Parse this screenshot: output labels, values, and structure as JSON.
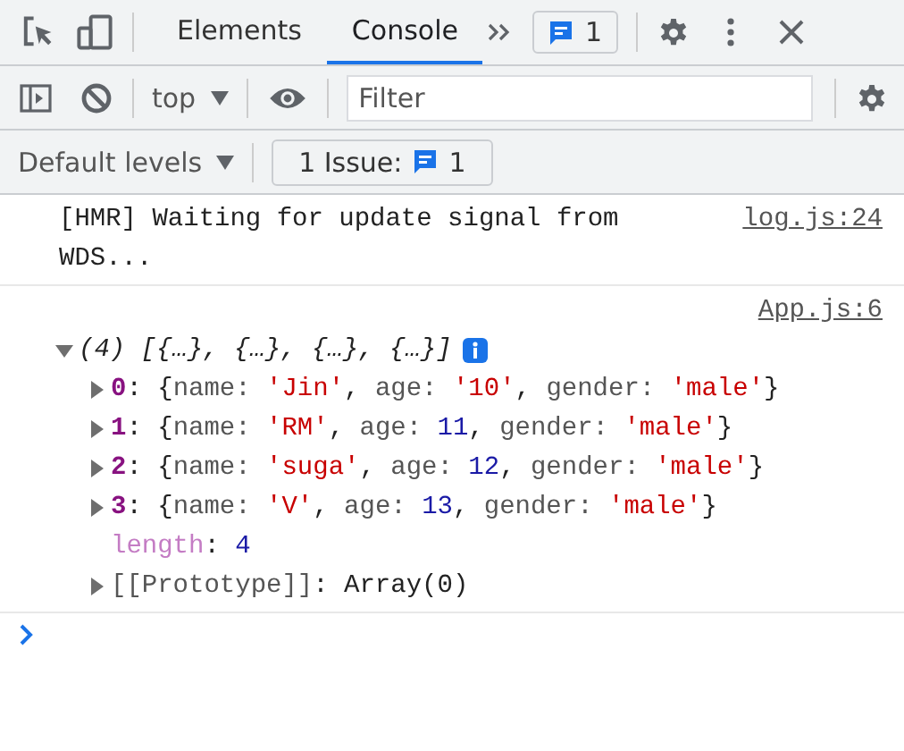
{
  "tabs": [
    {
      "label": "Elements",
      "selected": false
    },
    {
      "label": "Console",
      "selected": true
    }
  ],
  "message_badge": {
    "count": "1"
  },
  "toolbar": {
    "context": "top",
    "filter": {
      "placeholder": "Filter"
    }
  },
  "levels": {
    "label": "Default levels",
    "issues_label": "1 Issue:",
    "issues_count": "1"
  },
  "messages": [
    {
      "text": "[HMR] Waiting for update signal from WDS...",
      "source": "log.js:24"
    },
    {
      "source": "App.js:6",
      "lines": [
        {
          "kind": "expandable",
          "expanded": true,
          "info": true,
          "tokens": [
            {
              "kind": "italic",
              "t": "(4) [{…}, {…}, {…}, {…}]"
            }
          ],
          "children": [
            {
              "kind": "expandable",
              "expanded": false,
              "tokens": [
                {
                  "kind": "index",
                  "t": "0"
                },
                {
                  "kind": "plain",
                  "t": ": {"
                },
                {
                  "kind": "key",
                  "t": "name: "
                },
                {
                  "kind": "str",
                  "t": "'Jin'"
                },
                {
                  "kind": "plain",
                  "t": ", "
                },
                {
                  "kind": "key",
                  "t": "age: "
                },
                {
                  "kind": "str",
                  "t": "'10'"
                },
                {
                  "kind": "plain",
                  "t": ", "
                },
                {
                  "kind": "key",
                  "t": "gender: "
                },
                {
                  "kind": "str",
                  "t": "'male'"
                },
                {
                  "kind": "plain",
                  "t": "}"
                }
              ]
            },
            {
              "kind": "expandable",
              "expanded": false,
              "tokens": [
                {
                  "kind": "index",
                  "t": "1"
                },
                {
                  "kind": "plain",
                  "t": ": {"
                },
                {
                  "kind": "key",
                  "t": "name: "
                },
                {
                  "kind": "str",
                  "t": "'RM'"
                },
                {
                  "kind": "plain",
                  "t": ", "
                },
                {
                  "kind": "key",
                  "t": "age: "
                },
                {
                  "kind": "num",
                  "t": "11"
                },
                {
                  "kind": "plain",
                  "t": ", "
                },
                {
                  "kind": "key",
                  "t": "gender: "
                },
                {
                  "kind": "str",
                  "t": "'male'"
                },
                {
                  "kind": "plain",
                  "t": "}"
                }
              ]
            },
            {
              "kind": "expandable",
              "expanded": false,
              "tokens": [
                {
                  "kind": "index",
                  "t": "2"
                },
                {
                  "kind": "plain",
                  "t": ": {"
                },
                {
                  "kind": "key",
                  "t": "name: "
                },
                {
                  "kind": "str",
                  "t": "'suga'"
                },
                {
                  "kind": "plain",
                  "t": ", "
                },
                {
                  "kind": "key",
                  "t": "age: "
                },
                {
                  "kind": "num",
                  "t": "12"
                },
                {
                  "kind": "plain",
                  "t": ", "
                },
                {
                  "kind": "key",
                  "t": "gender: "
                },
                {
                  "kind": "str",
                  "t": "'male'"
                },
                {
                  "kind": "plain",
                  "t": "}"
                }
              ]
            },
            {
              "kind": "expandable",
              "expanded": false,
              "tokens": [
                {
                  "kind": "index",
                  "t": "3"
                },
                {
                  "kind": "plain",
                  "t": ": {"
                },
                {
                  "kind": "key",
                  "t": "name: "
                },
                {
                  "kind": "str",
                  "t": "'V'"
                },
                {
                  "kind": "plain",
                  "t": ", "
                },
                {
                  "kind": "key",
                  "t": "age: "
                },
                {
                  "kind": "num",
                  "t": "13"
                },
                {
                  "kind": "plain",
                  "t": ", "
                },
                {
                  "kind": "key",
                  "t": "gender: "
                },
                {
                  "kind": "str",
                  "t": "'male'"
                },
                {
                  "kind": "plain",
                  "t": "}"
                }
              ]
            },
            {
              "kind": "leaf",
              "tokens": [
                {
                  "kind": "meta",
                  "t": "length"
                },
                {
                  "kind": "plain",
                  "t": ": "
                },
                {
                  "kind": "num",
                  "t": "4"
                }
              ]
            },
            {
              "kind": "expandable",
              "expanded": false,
              "tokens": [
                {
                  "kind": "key",
                  "t": "[[Prototype]]"
                },
                {
                  "kind": "plain",
                  "t": ": Array(0)"
                }
              ]
            }
          ]
        }
      ]
    }
  ]
}
